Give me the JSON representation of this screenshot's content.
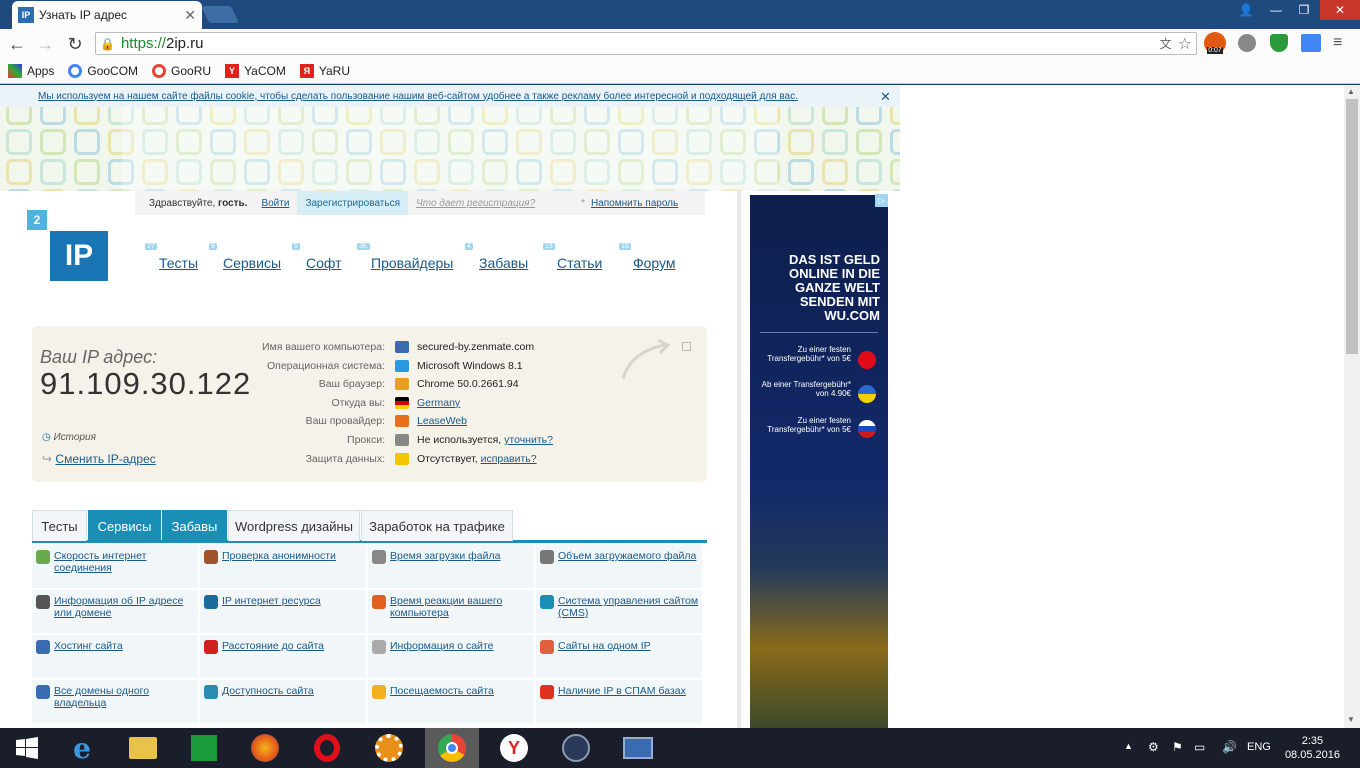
{
  "browser": {
    "tab_title": "Узнать IP адрес",
    "tab_favicon": "IP",
    "url_scheme": "https://",
    "url_host": "2ip.ru",
    "bookmarks": [
      {
        "label": "Apps",
        "icon": "apps-grid-icon"
      },
      {
        "label": "GooCOM",
        "icon": "google-icon"
      },
      {
        "label": "GooRU",
        "icon": "google-icon"
      },
      {
        "label": "YaCOM",
        "icon": "yandex-icon"
      },
      {
        "label": "YaRU",
        "icon": "yandex-icon"
      }
    ],
    "ext_timer": "0:07"
  },
  "page": {
    "cookie_notice": "Мы используем на нашем сайте файлы cookie, чтобы сделать пользование нашим веб-сайтом удобнее а также рекламу более интересной и подходящей для вас.",
    "login": {
      "greeting": "Здравствуйте,",
      "guest": "гость.",
      "login": "Войти",
      "register": "Зарегистрироваться",
      "what_reg": "Что дает регистрация?",
      "remind": "Напомнить пароль"
    },
    "logo": {
      "badge": "2",
      "text": "IP"
    },
    "menu": [
      {
        "label": "Тесты",
        "count": "27"
      },
      {
        "label": "Сервисы",
        "count": "9"
      },
      {
        "label": "Софт",
        "count": "5"
      },
      {
        "label": "Провайдеры",
        "count": "3K"
      },
      {
        "label": "Забавы",
        "count": "4"
      },
      {
        "label": "Статьи",
        "count": "13"
      },
      {
        "label": "Форум",
        "count": "15"
      }
    ],
    "ip_block": {
      "label": "Ваш IP адрес:",
      "ip": "91.109.30.122",
      "history": "История",
      "change": "Сменить IP-адрес",
      "rows": [
        {
          "label": "Имя вашего компьютера:",
          "value": "secured-by.zenmate.com",
          "icon": "computer-icon",
          "link": false
        },
        {
          "label": "Операционная система:",
          "value": "Microsoft Windows 8.1",
          "icon": "windows-icon",
          "link": false
        },
        {
          "label": "Ваш браузер:",
          "value": "Chrome 50.0.2661.94",
          "icon": "chrome-icon",
          "link": false
        },
        {
          "label": "Откуда вы:",
          "value": "Germany",
          "icon": "germany-flag-icon",
          "link": true
        },
        {
          "label": "Ваш провайдер:",
          "value": "LeaseWeb",
          "icon": "provider-icon",
          "link": true
        },
        {
          "label": "Прокси:",
          "value": "Не используется,",
          "extra": "уточнить?",
          "icon": "glasses-icon",
          "link": false
        },
        {
          "label": "Защита данных:",
          "value": "Отсутствует,",
          "extra": "исправить?",
          "icon": "warning-icon",
          "link": false
        }
      ]
    },
    "tabs": [
      "Тесты",
      "Сервисы",
      "Забавы",
      "Wordpress дизайны",
      "Заработок на трафике"
    ],
    "services": [
      [
        "Скорость интернет соединения",
        "Проверка анонимности",
        "Время загрузки файла",
        "Объем загружаемого файла"
      ],
      [
        "Информация об IP адресе или домене",
        "IP интернет ресурса",
        "Время реакции вашего компьютера",
        "Система управления сайтом (CMS)"
      ],
      [
        "Хостинг сайта",
        "Расстояние до сайта",
        "Информация о сайте",
        "Сайты на одном IP"
      ],
      [
        "Все домены одного владельца",
        "Доступность сайта",
        "Посещаемость сайта",
        "Наличие IP в СПАМ базах"
      ]
    ],
    "ad": {
      "headline": "DAS IST GELD ONLINE IN DIE GANZE WELT SENDEN MIT WU.COM",
      "offers": [
        "Zu einer festen Transfergebühr* von 5€",
        "Ab einer Transfergebühr* von 4.90€",
        "Zu einer festen Transfergebühr* von 5€"
      ]
    }
  },
  "taskbar": {
    "lang": "ENG",
    "time": "2:35",
    "date": "08.05.2016"
  }
}
